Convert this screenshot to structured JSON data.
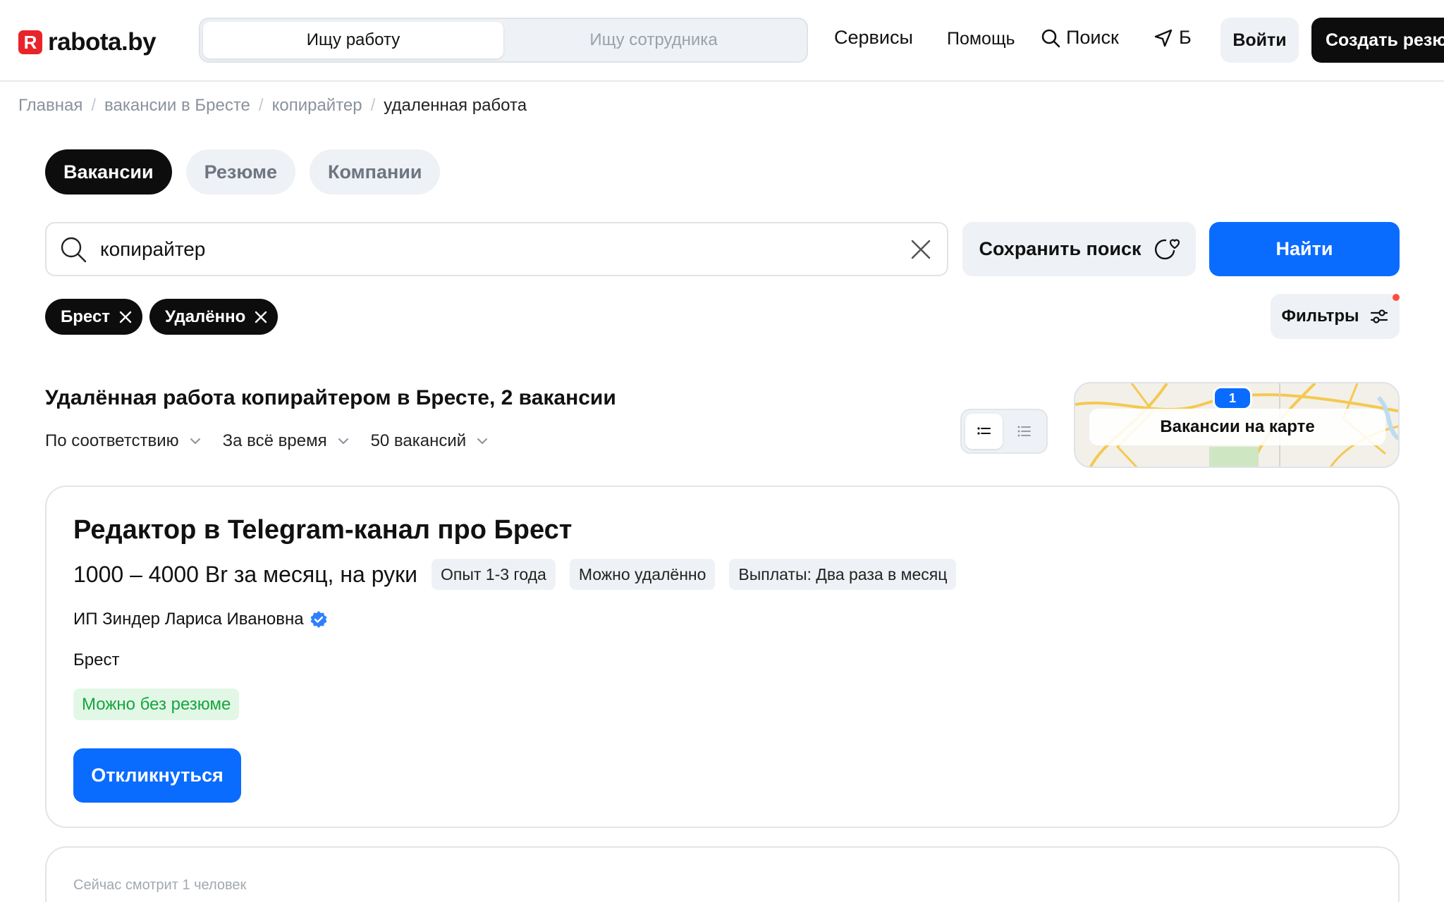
{
  "header": {
    "logo_letter": "R",
    "logo_text": "rabota.by",
    "role_switch": [
      "Ищу работу",
      "Ищу сотрудника"
    ],
    "nav": {
      "services": "Сервисы",
      "help": "Помощь",
      "search": "Поиск",
      "location": "Б"
    },
    "login": "Войти",
    "create_resume": "Создать резюме"
  },
  "breadcrumb": [
    "Главная",
    "вакансии в Бресте",
    "копирайтер",
    "удаленная работа"
  ],
  "tabs": [
    "Вакансии",
    "Резюме",
    "Компании"
  ],
  "search": {
    "value": "копирайтер",
    "save_label": "Сохранить поиск",
    "find_label": "Найти"
  },
  "chips": [
    "Брест",
    "Удалённо"
  ],
  "filters_label": "Фильтры",
  "results": {
    "title": "Удалённая работа копирайтером в Бресте, 2 вакансии",
    "sort": "По соответствию",
    "period": "За всё время",
    "per_page": "50 вакансий",
    "map_label": "Вакансии на карте",
    "map_pin_count": "1"
  },
  "vacancy": {
    "title": "Редактор в Telegram-канал про Брест",
    "salary": "1000 – 4000 Br за месяц, на руки",
    "tags": [
      "Опыт 1-3 года",
      "Можно удалённо",
      "Выплаты: Два раза в месяц"
    ],
    "company": "ИП Зиндер Лариса Ивановна",
    "city": "Брест",
    "no_resume": "Можно без резюме",
    "apply": "Откликнуться"
  },
  "vacancy2": {
    "watching": "Сейчас смотрит 1 человек"
  },
  "colors": {
    "brand_red": "#e8242a",
    "accent_blue": "#0a6cff",
    "dark": "#0d0d0d",
    "green_text": "#14a63e"
  }
}
